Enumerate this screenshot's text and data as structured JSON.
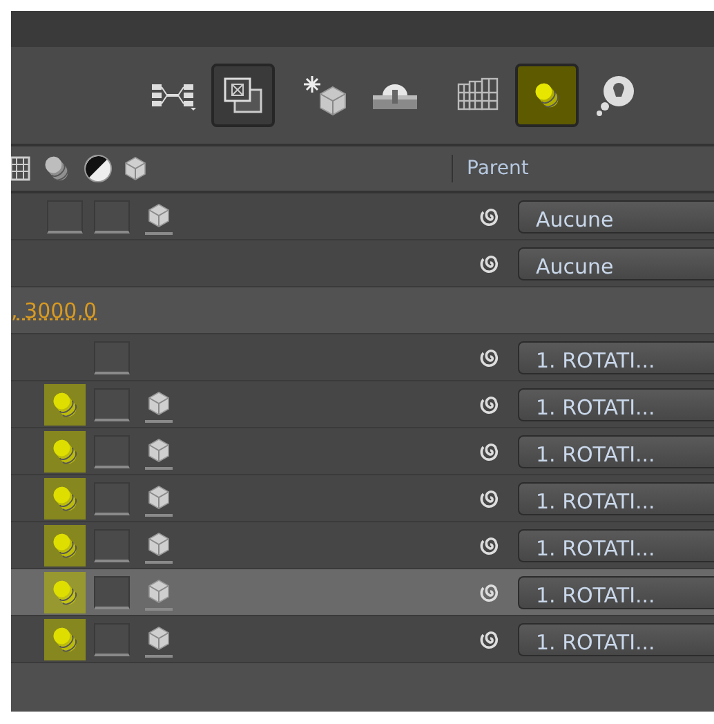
{
  "toolbar": {
    "buttons": [
      {
        "kind": "flowchart",
        "selected": false
      },
      {
        "kind": "draft-3d",
        "selected": true
      },
      {
        "kind": "light-cube",
        "selected": false
      },
      {
        "kind": "shy",
        "selected": false
      },
      {
        "kind": "frame-blend",
        "selected": false
      },
      {
        "kind": "motion-blur",
        "selected": true
      },
      {
        "kind": "bulb",
        "selected": false
      }
    ]
  },
  "header": {
    "parent_label": "Parent"
  },
  "rows": [
    {
      "kind": "layer",
      "selected": false,
      "switches": [
        {
          "kind": "motion-blur",
          "on": false
        },
        {
          "kind": "adjustment",
          "on": false
        },
        {
          "kind": "cube",
          "on": true
        }
      ],
      "parent": "Aucune"
    },
    {
      "kind": "layer",
      "selected": false,
      "switches": [
        {
          "kind": "blank"
        },
        {
          "kind": "blank"
        },
        {
          "kind": "blank"
        }
      ],
      "parent": "Aucune"
    },
    {
      "kind": "property",
      "value": ", 3000,0"
    },
    {
      "kind": "layer",
      "selected": false,
      "switches": [
        {
          "kind": "blank"
        },
        {
          "kind": "adjustment",
          "on": false
        },
        {
          "kind": "blank"
        }
      ],
      "parent": "1. ROTATI..."
    },
    {
      "kind": "layer",
      "selected": false,
      "switches": [
        {
          "kind": "motion-blur",
          "on": true
        },
        {
          "kind": "adjustment",
          "on": false
        },
        {
          "kind": "cube",
          "on": true
        }
      ],
      "parent": "1. ROTATI..."
    },
    {
      "kind": "layer",
      "selected": false,
      "switches": [
        {
          "kind": "motion-blur",
          "on": true
        },
        {
          "kind": "adjustment",
          "on": false
        },
        {
          "kind": "cube",
          "on": true
        }
      ],
      "parent": "1. ROTATI..."
    },
    {
      "kind": "layer",
      "selected": false,
      "switches": [
        {
          "kind": "motion-blur",
          "on": true
        },
        {
          "kind": "adjustment",
          "on": false
        },
        {
          "kind": "cube",
          "on": true
        }
      ],
      "parent": "1. ROTATI..."
    },
    {
      "kind": "layer",
      "selected": false,
      "switches": [
        {
          "kind": "motion-blur",
          "on": true
        },
        {
          "kind": "adjustment",
          "on": false
        },
        {
          "kind": "cube",
          "on": true
        }
      ],
      "parent": "1. ROTATI..."
    },
    {
      "kind": "layer",
      "selected": true,
      "switches": [
        {
          "kind": "motion-blur",
          "on": true
        },
        {
          "kind": "adjustment",
          "on": false
        },
        {
          "kind": "cube",
          "on": true
        }
      ],
      "parent": "1. ROTATI..."
    },
    {
      "kind": "layer",
      "selected": false,
      "switches": [
        {
          "kind": "motion-blur",
          "on": true
        },
        {
          "kind": "adjustment",
          "on": false
        },
        {
          "kind": "cube",
          "on": true
        }
      ],
      "parent": "1. ROTATI..."
    }
  ]
}
